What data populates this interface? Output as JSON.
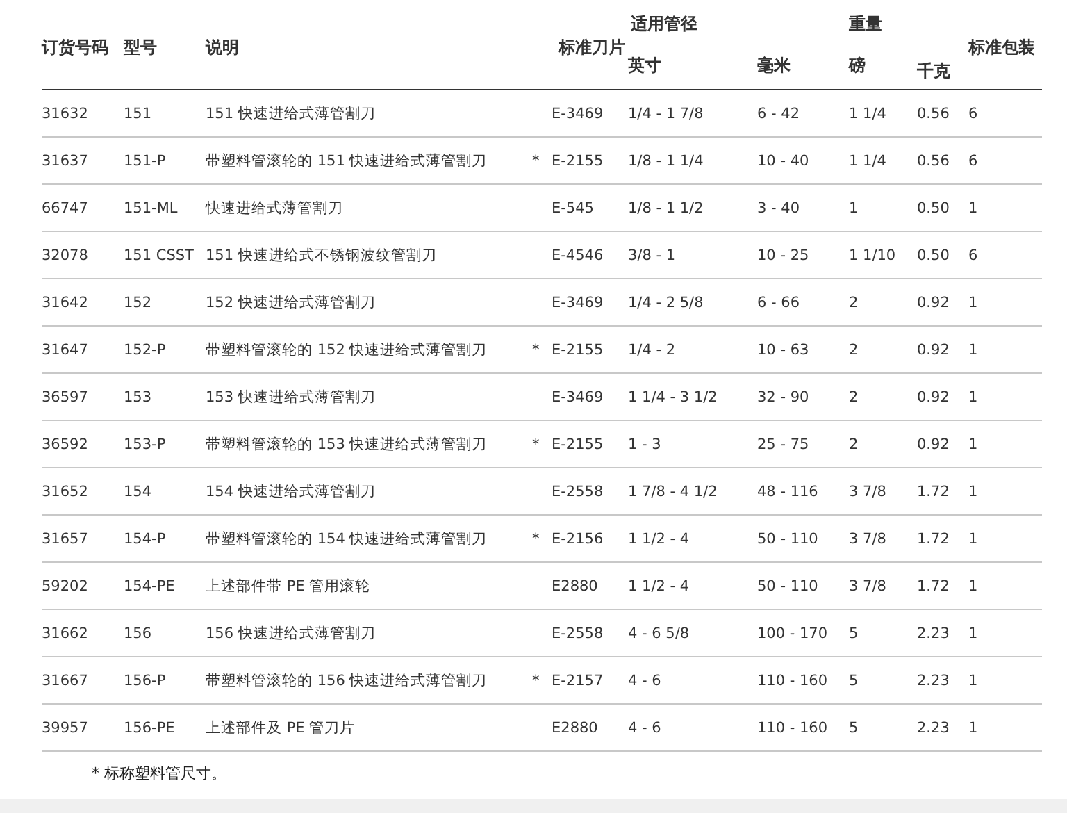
{
  "table": {
    "headers": {
      "order_no": "订货号码",
      "model": "型号",
      "description": "说明",
      "blade": "标准刀片",
      "pipe_group": "适用管径",
      "inch": "英寸",
      "mm": "毫米",
      "weight_group": "重量",
      "lb": "磅",
      "kg": "千克",
      "pack": "标准包装"
    },
    "rows": [
      {
        "order_no": "31632",
        "model": "151",
        "description": "151 快速进给式薄管割刀",
        "blade": "E-3469",
        "inch": "1/4 - 1 7/8",
        "mm": "6 - 42",
        "lb": "1 1/4",
        "kg": "0.56",
        "pack": "6"
      },
      {
        "order_no": "31637",
        "model": "151-P",
        "description": "带塑料管滚轮的 151 快速进给式薄管割刀",
        "note": "*",
        "blade": "E-2155",
        "inch": "1/8 - 1 1/4",
        "mm": "10 - 40",
        "lb": "1 1/4",
        "kg": "0.56",
        "pack": "6"
      },
      {
        "order_no": "66747",
        "model": "151-ML",
        "description": "快速进给式薄管割刀",
        "blade": "E-545",
        "inch": "1/8 - 1 1/2",
        "mm": "3 - 40",
        "lb": "1",
        "kg": "0.50",
        "pack": "1"
      },
      {
        "order_no": "32078",
        "model": "151 CSST",
        "description": "151 快速进给式不锈钢波纹管割刀",
        "blade": "E-4546",
        "inch": "3/8 - 1",
        "mm": "10 - 25",
        "lb": "1 1/10",
        "kg": "0.50",
        "pack": "6"
      },
      {
        "order_no": "31642",
        "model": "152",
        "description": "152 快速进给式薄管割刀",
        "blade": "E-3469",
        "inch": "1/4 - 2 5/8",
        "mm": "6 - 66",
        "lb": "2",
        "kg": "0.92",
        "pack": "1"
      },
      {
        "order_no": "31647",
        "model": "152-P",
        "description": "带塑料管滚轮的 152 快速进给式薄管割刀",
        "note": "*",
        "blade": "E-2155",
        "inch": "1/4 - 2",
        "mm": "10 - 63",
        "lb": "2",
        "kg": "0.92",
        "pack": "1"
      },
      {
        "order_no": "36597",
        "model": "153",
        "description": "153 快速进给式薄管割刀",
        "blade": "E-3469",
        "inch": "1 1/4 - 3 1/2",
        "mm": "32 - 90",
        "lb": "2",
        "kg": "0.92",
        "pack": "1"
      },
      {
        "order_no": "36592",
        "model": "153-P",
        "description": "带塑料管滚轮的 153 快速进给式薄管割刀",
        "note": "*",
        "blade": "E-2155",
        "inch": "1 - 3",
        "mm": "25 - 75",
        "lb": "2",
        "kg": "0.92",
        "pack": "1"
      },
      {
        "order_no": "31652",
        "model": "154",
        "description": "154 快速进给式薄管割刀",
        "blade": "E-2558",
        "inch": "1 7/8 - 4 1/2",
        "mm": "48 - 116",
        "lb": "3 7/8",
        "kg": "1.72",
        "pack": "1"
      },
      {
        "order_no": "31657",
        "model": "154-P",
        "description": "带塑料管滚轮的 154 快速进给式薄管割刀",
        "note": "*",
        "blade": "E-2156",
        "inch": "1 1/2 - 4",
        "mm": "50 - 110",
        "lb": "3 7/8",
        "kg": "1.72",
        "pack": "1"
      },
      {
        "order_no": "59202",
        "model": "154-PE",
        "description": "上述部件带 PE 管用滚轮",
        "blade": "E2880",
        "inch": "1 1/2 - 4",
        "mm": "50 - 110",
        "lb": "3 7/8",
        "kg": "1.72",
        "pack": "1"
      },
      {
        "order_no": "31662",
        "model": "156",
        "description": "156 快速进给式薄管割刀",
        "blade": "E-2558",
        "inch": "4 - 6 5/8",
        "mm": "100 - 170",
        "lb": "5",
        "kg": "2.23",
        "pack": "1"
      },
      {
        "order_no": "31667",
        "model": "156-P",
        "description": "带塑料管滚轮的 156 快速进给式薄管割刀",
        "note": "*",
        "blade": "E-2157",
        "inch": "4 - 6",
        "mm": "110 - 160",
        "lb": "5",
        "kg": "2.23",
        "pack": "1"
      },
      {
        "order_no": "39957",
        "model": "156-PE",
        "description": "上述部件及 PE 管刀片",
        "blade": "E2880",
        "inch": "4 - 6",
        "mm": "110 - 160",
        "lb": "5",
        "kg": "2.23",
        "pack": "1"
      }
    ]
  },
  "footnote": "* 标称塑料管尺寸。"
}
